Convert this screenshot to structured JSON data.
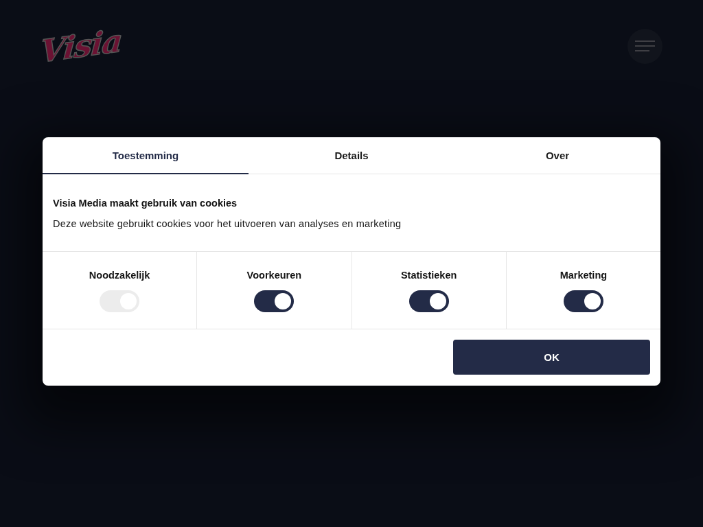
{
  "header": {
    "logo": "Visia"
  },
  "dialog": {
    "tabs": [
      {
        "label": "Toestemming",
        "selected": true
      },
      {
        "label": "Details",
        "selected": false
      },
      {
        "label": "Over",
        "selected": false
      }
    ],
    "title": "Visia Media maakt gebruik van cookies",
    "description": "Deze website gebruikt cookies voor het uitvoeren van analyses en marketing",
    "categories": [
      {
        "label": "Noodzakelijk",
        "checked": true,
        "disabled": true
      },
      {
        "label": "Voorkeuren",
        "checked": true,
        "disabled": false
      },
      {
        "label": "Statistieken",
        "checked": true,
        "disabled": false
      },
      {
        "label": "Marketing",
        "checked": true,
        "disabled": false
      }
    ],
    "button": "OK"
  }
}
